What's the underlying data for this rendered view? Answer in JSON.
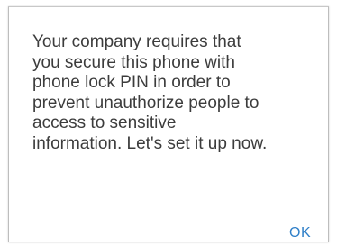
{
  "dialog": {
    "message": "Your company requires that\nyou secure this phone with\nphone lock PIN in order to\nprevent unauthorize people to\naccess to sensitive\ninformation. Let's set it up now.",
    "ok_label": "OK"
  },
  "colors": {
    "text": "#3c3c3c",
    "accent": "#2f7fc8",
    "border": "#bdbdbd"
  }
}
